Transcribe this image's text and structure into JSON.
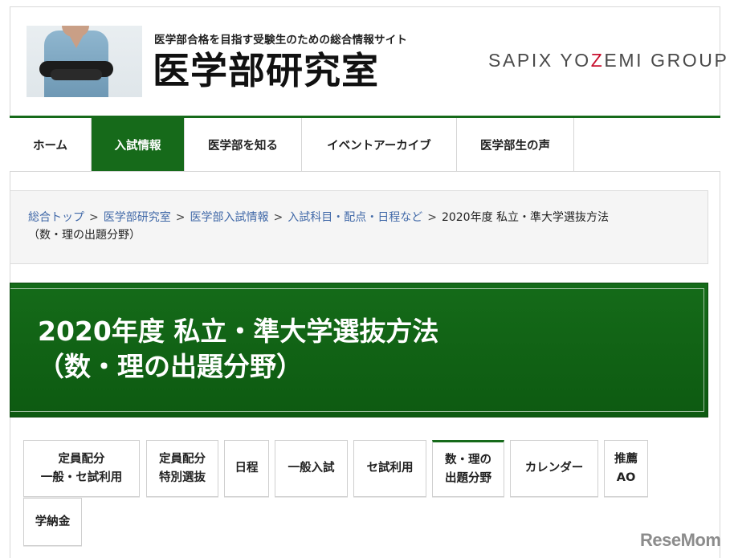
{
  "header": {
    "tagline": "医学部合格を目指す受験生のための総合情報サイト",
    "site_title": "医学部研究室",
    "brand_pre": "SAPIX YO",
    "brand_z": "Z",
    "brand_post": "EMI GROUP"
  },
  "nav": {
    "items": [
      {
        "label": "ホーム"
      },
      {
        "label": "入試情報"
      },
      {
        "label": "医学部を知る"
      },
      {
        "label": "イベントアーカイブ"
      },
      {
        "label": "医学部生の声"
      }
    ],
    "active_index": 1
  },
  "breadcrumb": {
    "links": [
      "総合トップ",
      "医学部研究室",
      "医学部入試情報",
      "入試科目・配点・日程など"
    ],
    "separator": ">",
    "current_line1": "2020年度 私立・準大学選抜方法",
    "current_line2": "（数・理の出題分野）"
  },
  "banner": {
    "line1": "2020年度 私立・準大学選抜方法",
    "line2": "（数・理の出題分野）"
  },
  "tabs": [
    {
      "line1": "定員配分",
      "line2": "一般・セ試利用"
    },
    {
      "line1": "定員配分",
      "line2": "特別選抜"
    },
    {
      "line1": "日程",
      "line2": ""
    },
    {
      "line1": "一般入試",
      "line2": ""
    },
    {
      "line1": "セ試利用",
      "line2": ""
    },
    {
      "line1": "数・理の",
      "line2": "出題分野"
    },
    {
      "line1": "カレンダー",
      "line2": ""
    },
    {
      "line1": "推薦",
      "line2": "AO"
    },
    {
      "line1": "学納金",
      "line2": ""
    }
  ],
  "watermark": "ReseMom",
  "colors": {
    "accent": "#166a1a",
    "link": "#4169a8",
    "brand_z": "#c8102e"
  }
}
